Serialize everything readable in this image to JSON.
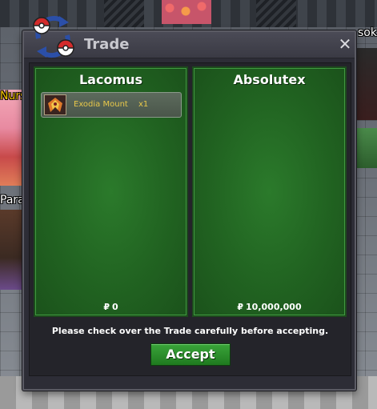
{
  "window": {
    "title": "Trade",
    "close_label": "✕"
  },
  "world": {
    "name_tags": {
      "left_top": "Nurse",
      "left_bottom": "Para",
      "right_top": "sok"
    }
  },
  "trade": {
    "left_player": {
      "name": "Lacomus",
      "money": "0",
      "items": [
        {
          "name": "Exodia Mount",
          "quantity": "x1",
          "icon": "exodia-mount-icon"
        }
      ]
    },
    "right_player": {
      "name": "Absolutex",
      "money": "10,000,000",
      "items": []
    },
    "currency_symbol": "₽",
    "notice": "Please check over the Trade carefully before accepting.",
    "accept_label": "Accept"
  },
  "colors": {
    "panel_green": "#216321",
    "accept_green": "#2a8f2a",
    "item_text_gold": "#e8c84a",
    "window_bg": "#2d2d36"
  }
}
